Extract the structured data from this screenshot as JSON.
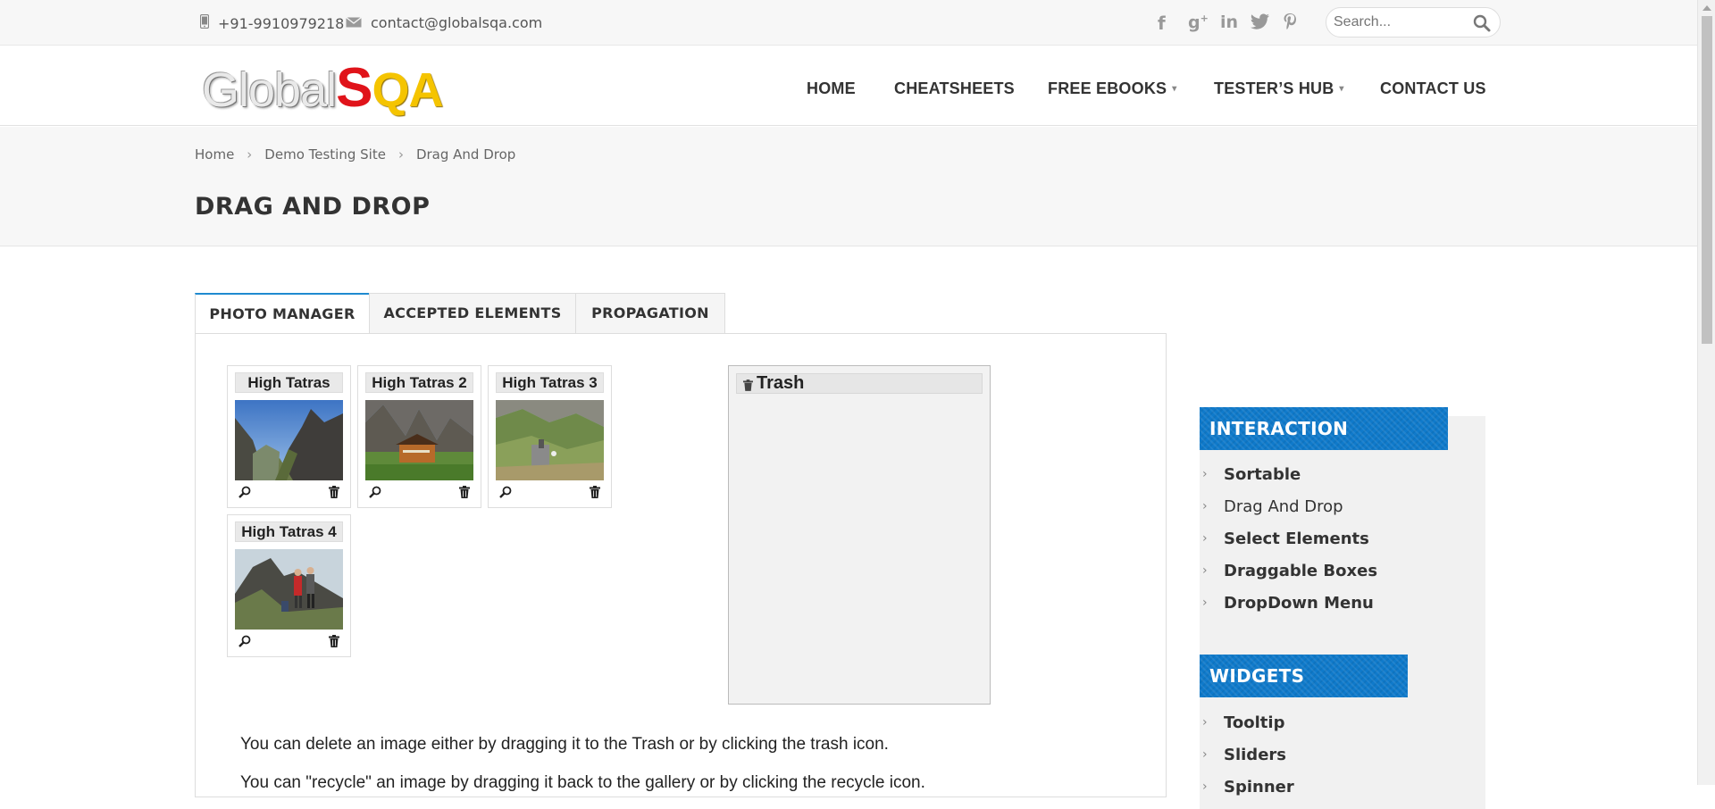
{
  "topbar": {
    "phone": "+91-9910979218",
    "email": "contact@globalsqa.com",
    "social": [
      "f",
      "g+",
      "in",
      "twitter",
      "p"
    ],
    "search_placeholder": "Search..."
  },
  "logo": {
    "part1": "Global",
    "part2": "S",
    "part3": "QA"
  },
  "nav": {
    "items": [
      {
        "label": "HOME"
      },
      {
        "label": "CHEATSHEETS"
      },
      {
        "label": "FREE EBOOKS"
      },
      {
        "label": "TESTER’S HUB"
      },
      {
        "label": "CONTACT US"
      }
    ]
  },
  "breadcrumb": [
    "Home",
    "Demo Testing Site",
    "Drag And Drop"
  ],
  "page_title": "DRAG AND DROP",
  "tabs": [
    "PHOTO MANAGER",
    "ACCEPTED ELEMENTS",
    "PROPAGATION"
  ],
  "gallery": {
    "items": [
      {
        "title": "High Tatras"
      },
      {
        "title": "High Tatras 2"
      },
      {
        "title": "High Tatras 3"
      },
      {
        "title": "High Tatras 4"
      }
    ]
  },
  "trash": {
    "title": "Trash"
  },
  "description": [
    "You can delete an image either by dragging it to the Trash or by clicking the trash icon.",
    "You can \"recycle\" an image by dragging it back to the gallery or by clicking the recycle icon."
  ],
  "sidebar": {
    "interaction_title": "INTERACTION",
    "interaction_items": [
      "Sortable",
      "Drag And Drop",
      "Select Elements",
      "Draggable Boxes",
      "DropDown Menu"
    ],
    "widgets_title": "WIDGETS",
    "widgets_items": [
      "Tooltip",
      "Sliders",
      "Spinner"
    ]
  },
  "colors": {
    "accent": "#1f8ad0",
    "sidebar_head": "#0f7acb",
    "logo_s": "#e0131a",
    "logo_qa": "#f5c400"
  },
  "icons": {
    "phone": "phone-icon",
    "email": "envelope-icon",
    "search": "search-icon",
    "zoom": "zoom-icon",
    "trash": "trash-icon"
  }
}
